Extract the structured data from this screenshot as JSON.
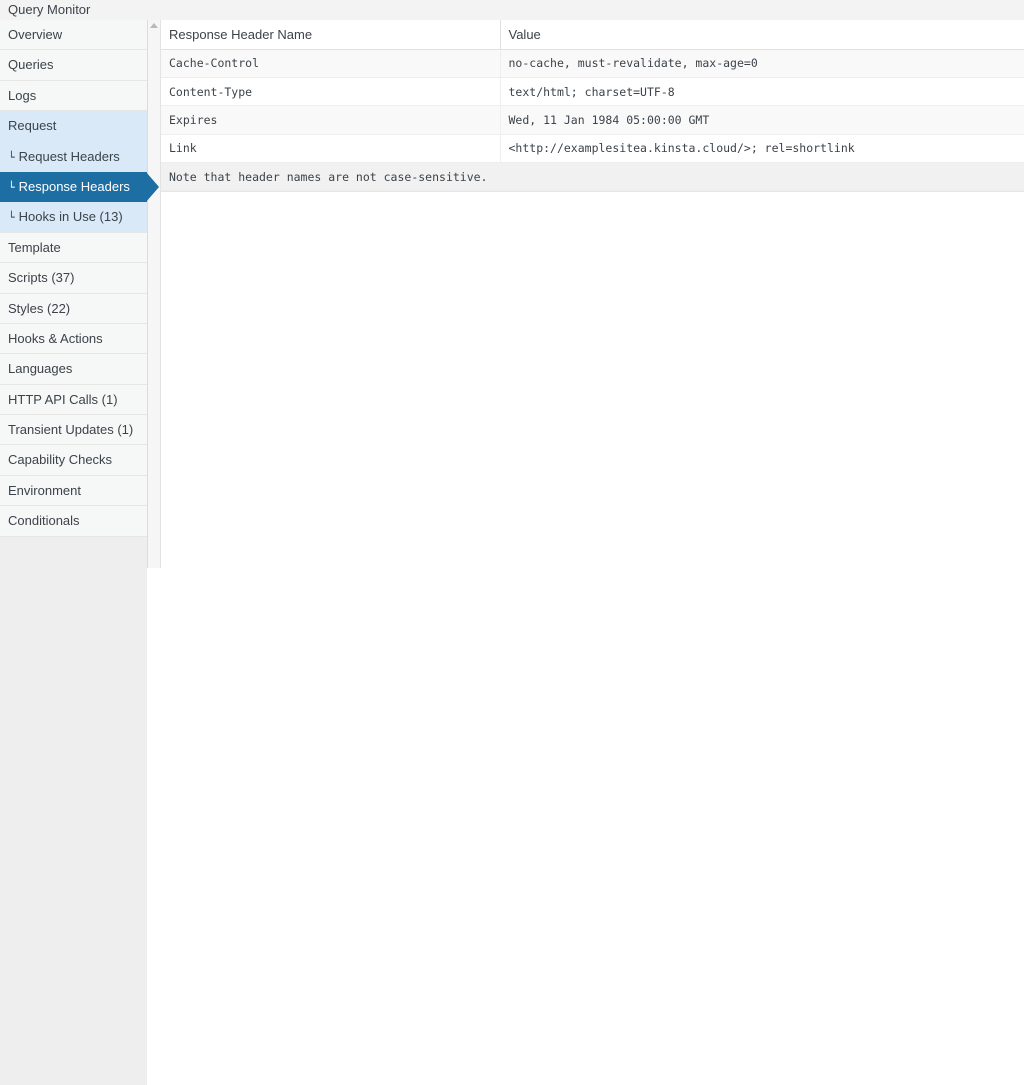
{
  "panel": {
    "title": "Query Monitor"
  },
  "sidebar": {
    "items": [
      {
        "label": "Overview",
        "state": "normal",
        "sub": false
      },
      {
        "label": "Queries",
        "state": "normal",
        "sub": false
      },
      {
        "label": "Logs",
        "state": "normal",
        "sub": false
      },
      {
        "label": "Request",
        "state": "parent-open",
        "sub": false
      },
      {
        "label": "Request Headers",
        "state": "sub",
        "sub": true,
        "prefix": "└"
      },
      {
        "label": "Response Headers",
        "state": "active",
        "sub": true,
        "prefix": "└"
      },
      {
        "label": "Hooks in Use (13)",
        "state": "sub",
        "sub": true,
        "prefix": "└"
      },
      {
        "label": "Template",
        "state": "normal",
        "sub": false
      },
      {
        "label": "Scripts (37)",
        "state": "normal",
        "sub": false
      },
      {
        "label": "Styles (22)",
        "state": "normal",
        "sub": false
      },
      {
        "label": "Hooks & Actions",
        "state": "normal",
        "sub": false
      },
      {
        "label": "Languages",
        "state": "normal",
        "sub": false
      },
      {
        "label": "HTTP API Calls (1)",
        "state": "normal",
        "sub": false
      },
      {
        "label": "Transient Updates (1)",
        "state": "normal",
        "sub": false
      },
      {
        "label": "Capability Checks",
        "state": "normal",
        "sub": false
      },
      {
        "label": "Environment",
        "state": "normal",
        "sub": false
      },
      {
        "label": "Conditionals",
        "state": "normal",
        "sub": false
      }
    ]
  },
  "scrollbar": {
    "up_arrow_icon": "triangle-up-icon"
  },
  "table": {
    "columns": [
      "Response Header Name",
      "Value"
    ],
    "rows": [
      {
        "name": "Cache-Control",
        "value": "no-cache, must-revalidate, max-age=0"
      },
      {
        "name": "Content-Type",
        "value": "text/html; charset=UTF-8"
      },
      {
        "name": "Expires",
        "value": "Wed, 11 Jan 1984 05:00:00 GMT"
      },
      {
        "name": "Link",
        "value": "<http://examplesitea.kinsta.cloud/>; rel=shortlink"
      }
    ],
    "note": "Note that header names are not case-sensitive."
  },
  "colors": {
    "active_nav_bg": "#1d6ea3",
    "open_nav_bg": "#d9e9f8",
    "nav_bg": "#f6f7f7",
    "titlebar_bg": "#f3f3f3",
    "row_alt_bg": "#f9f9f9",
    "note_bg": "#f1f1f1",
    "text": "#3c434a"
  }
}
